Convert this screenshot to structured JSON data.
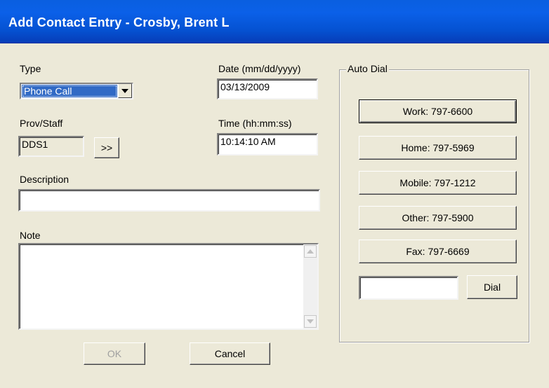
{
  "window": {
    "title": "Add Contact Entry - Crosby, Brent L"
  },
  "form": {
    "type_label": "Type",
    "type_value": "Phone Call",
    "date_label": "Date (mm/dd/yyyy)",
    "date_value": "03/13/2009",
    "prov_label": "Prov/Staff",
    "prov_value": "DDS1",
    "prov_button": ">>",
    "time_label": "Time (hh:mm:ss)",
    "time_value": "10:14:10 AM",
    "description_label": "Description",
    "description_value": "",
    "note_label": "Note",
    "note_value": ""
  },
  "buttons": {
    "ok": "OK",
    "cancel": "Cancel"
  },
  "auto_dial": {
    "label": "Auto Dial",
    "work": "Work:  797-6600",
    "home": "Home:  797-5969",
    "mobile": "Mobile:  797-1212",
    "other": "Other:  797-5900",
    "fax": "Fax:  797-6669",
    "dial_input": "",
    "dial_button": "Dial"
  },
  "icons": {
    "dropdown": "chevron-down-icon",
    "scroll_up": "arrow-up-icon",
    "scroll_down": "arrow-down-icon"
  }
}
